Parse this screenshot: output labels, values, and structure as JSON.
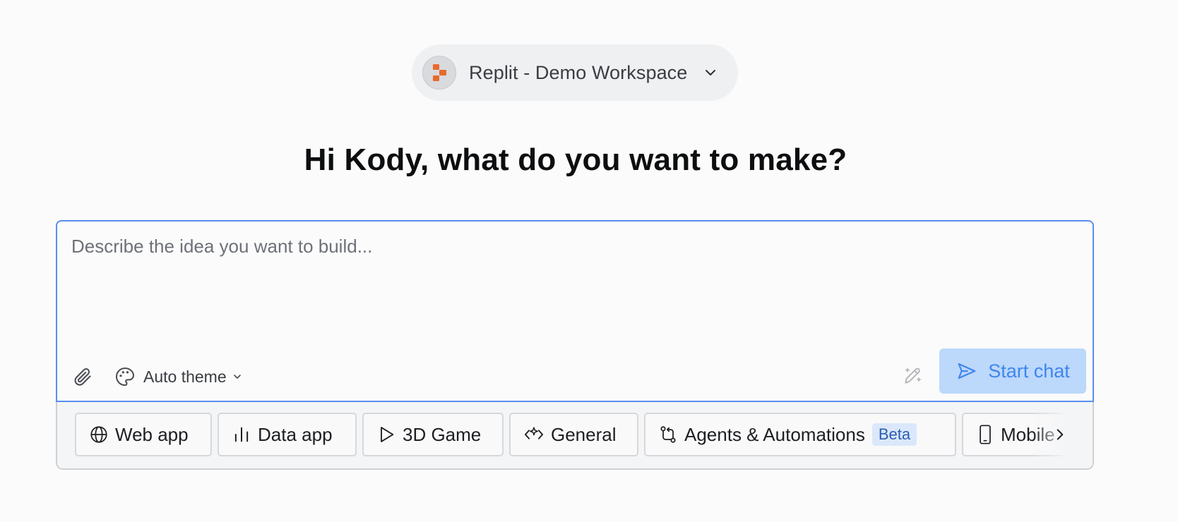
{
  "workspace": {
    "name": "Replit - Demo Workspace",
    "avatar_icon": "replit-logo",
    "accent": "#e8692c"
  },
  "heading": "Hi Kody, what do you want to make?",
  "composer": {
    "placeholder": "Describe the idea you want to build...",
    "value": "",
    "attach_icon": "paperclip-icon",
    "theme_label": "Auto theme",
    "theme_icon": "palette-icon",
    "improve_icon": "pen-sparkle-icon",
    "start_label": "Start chat",
    "start_icon": "send-icon"
  },
  "suggestions": [
    {
      "label": "Web app",
      "icon": "globe-icon"
    },
    {
      "label": "Data app",
      "icon": "bar-chart-icon"
    },
    {
      "label": "3D Game",
      "icon": "play-icon"
    },
    {
      "label": "General",
      "icon": "code-sparkle-icon"
    },
    {
      "label": "Agents & Automations",
      "icon": "workflow-icon",
      "badge": "Beta"
    },
    {
      "label": "Mobile",
      "icon": "phone-icon"
    }
  ],
  "colors": {
    "primary": "#3f86ee",
    "primary_soft": "#bcd8fb",
    "focus_border": "#5b8def"
  }
}
